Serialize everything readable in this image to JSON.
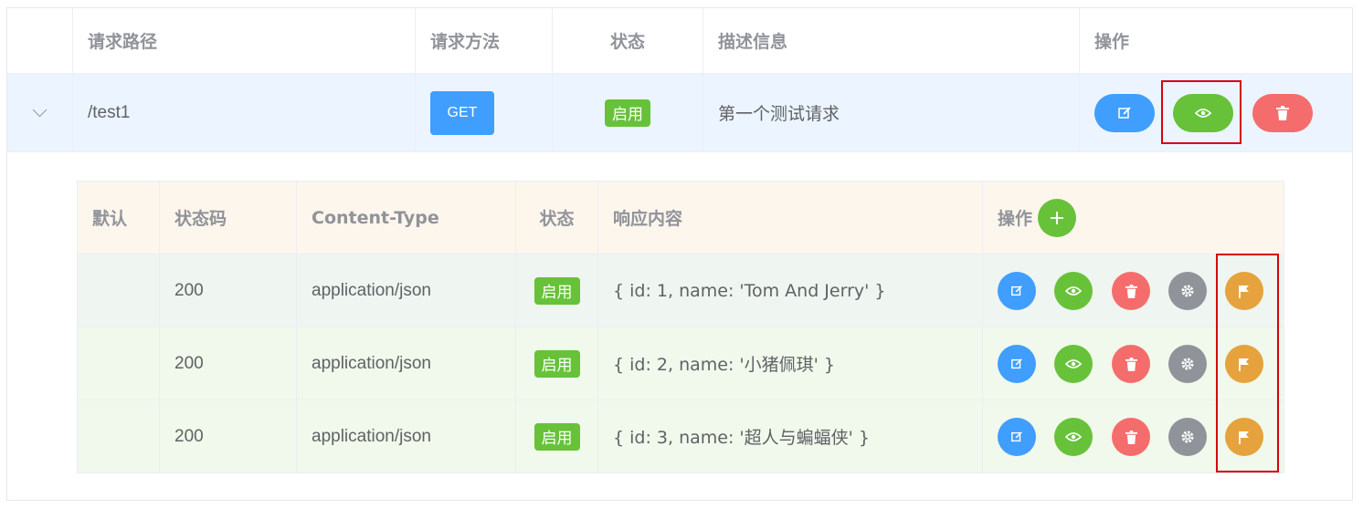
{
  "main_table": {
    "headers": {
      "path": "请求路径",
      "method": "请求方法",
      "status": "状态",
      "description": "描述信息",
      "actions": "操作"
    },
    "row": {
      "path": "/test1",
      "method": "GET",
      "status": "启用",
      "description": "第一个测试请求"
    }
  },
  "response_table": {
    "headers": {
      "default": "默认",
      "status_code": "状态码",
      "content_type": "Content-Type",
      "status": "状态",
      "body": "响应内容",
      "actions": "操作"
    },
    "rows": [
      {
        "status_code": "200",
        "content_type": "application/json",
        "status": "启用",
        "body": "{ id: 1, name: 'Tom And Jerry' }"
      },
      {
        "status_code": "200",
        "content_type": "application/json",
        "status": "启用",
        "body": "{ id: 2, name: '小猪佩琪' }"
      },
      {
        "status_code": "200",
        "content_type": "application/json",
        "status": "启用",
        "body": "{ id: 3, name: '超人与蝙蝠侠' }"
      }
    ]
  },
  "colors": {
    "primary": "#409eff",
    "success": "#67c23a",
    "danger": "#f56c6c",
    "info": "#909399",
    "warning": "#e6a23c",
    "highlight": "#d8000c"
  },
  "icons": [
    "chevron-down-icon",
    "edit-icon",
    "eye-icon",
    "trash-icon",
    "gear-icon",
    "flag-icon",
    "plus-icon"
  ]
}
